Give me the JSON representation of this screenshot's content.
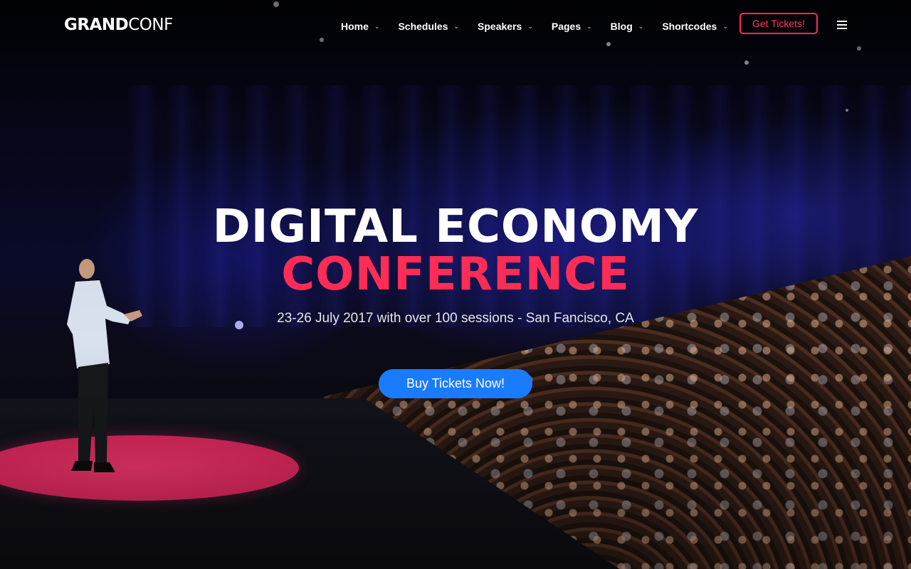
{
  "brand": {
    "logo_bold": "GRAND",
    "logo_light": "CONF"
  },
  "nav": {
    "items": [
      {
        "label": "Home",
        "has_dropdown": true
      },
      {
        "label": "Schedules",
        "has_dropdown": true
      },
      {
        "label": "Speakers",
        "has_dropdown": true
      },
      {
        "label": "Pages",
        "has_dropdown": true
      },
      {
        "label": "Blog",
        "has_dropdown": true
      },
      {
        "label": "Shortcodes",
        "has_dropdown": true
      }
    ],
    "tickets_button": "Get Tickets!",
    "menu_icon": "hamburger-menu-icon"
  },
  "hero": {
    "title_line1": "DIGITAL ECONOMY",
    "title_line2": "CONFERENCE",
    "subtitle": "23-26 July 2017 with over 100 sessions - San Fancisco, CA",
    "cta_label": "Buy Tickets Now!"
  },
  "colors": {
    "accent_red": "#ff2d55",
    "cta_blue": "#1a7bff",
    "background": "#05060f"
  }
}
